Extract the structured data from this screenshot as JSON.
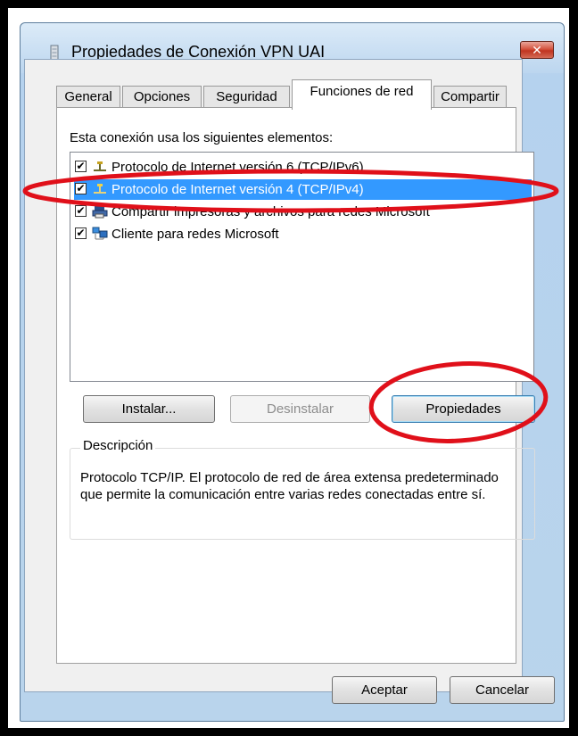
{
  "window": {
    "title": "Propiedades de Conexión VPN UAI",
    "close_glyph": "✕"
  },
  "tabs": [
    {
      "label": "General",
      "active": false
    },
    {
      "label": "Opciones",
      "active": false
    },
    {
      "label": "Seguridad",
      "active": false
    },
    {
      "label": "Funciones de red",
      "active": true
    },
    {
      "label": "Compartir",
      "active": false
    }
  ],
  "components": {
    "label": "Esta conexión usa los siguientes elementos:",
    "items": [
      {
        "label": "Protocolo de Internet versión 6 (TCP/IPv6)",
        "checked": true,
        "icon": "network-protocol-icon",
        "selected": false
      },
      {
        "label": "Protocolo de Internet versión 4 (TCP/IPv4)",
        "checked": true,
        "icon": "network-protocol-icon",
        "selected": true
      },
      {
        "label": "Compartir impresoras y archivos para redes Microsoft",
        "checked": true,
        "icon": "printer-share-icon",
        "selected": false
      },
      {
        "label": "Cliente para redes Microsoft",
        "checked": true,
        "icon": "network-client-icon",
        "selected": false
      }
    ]
  },
  "buttons": {
    "install": "Instalar...",
    "uninstall": "Desinstalar",
    "properties": "Propiedades",
    "ok": "Aceptar",
    "cancel": "Cancelar"
  },
  "description": {
    "title": "Descripción",
    "text": "Protocolo TCP/IP. El protocolo de red de área extensa predeterminado que permite la comunicación entre varias redes conectadas entre sí."
  },
  "colors": {
    "selection": "#3399ff",
    "annotation": "#e0101a",
    "background": "#000000"
  }
}
